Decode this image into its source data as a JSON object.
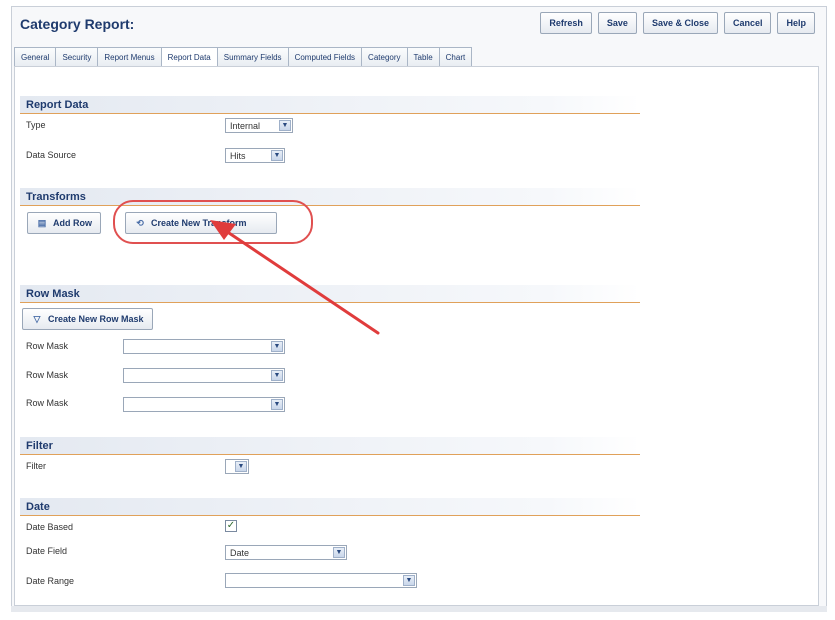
{
  "header": {
    "title": "Category Report:"
  },
  "toolbar": {
    "refresh": "Refresh",
    "save": "Save",
    "save_close": "Save & Close",
    "cancel": "Cancel",
    "help": "Help"
  },
  "tabs": [
    "General",
    "Security",
    "Report Menus",
    "Report Data",
    "Summary Fields",
    "Computed Fields",
    "Category",
    "Table",
    "Chart"
  ],
  "active_tab": "Report Data",
  "report_data": {
    "heading": "Report Data",
    "type_label": "Type",
    "type_value": "Internal",
    "source_label": "Data Source",
    "source_value": "Hits"
  },
  "transforms": {
    "heading": "Transforms",
    "add_row": "Add Row",
    "create_transform": "Create New Transform"
  },
  "row_mask": {
    "heading": "Row Mask",
    "create_mask": "Create New Row Mask",
    "labels": [
      "Row Mask",
      "Row Mask",
      "Row Mask"
    ]
  },
  "filter": {
    "heading": "Filter",
    "label": "Filter"
  },
  "date": {
    "heading": "Date",
    "based_label": "Date Based",
    "based_checked": true,
    "field_label": "Date Field",
    "field_value": "Date",
    "range_label": "Date Range"
  },
  "colors": {
    "accent": "#1f3b6e",
    "annotation": "#e03c3c"
  }
}
